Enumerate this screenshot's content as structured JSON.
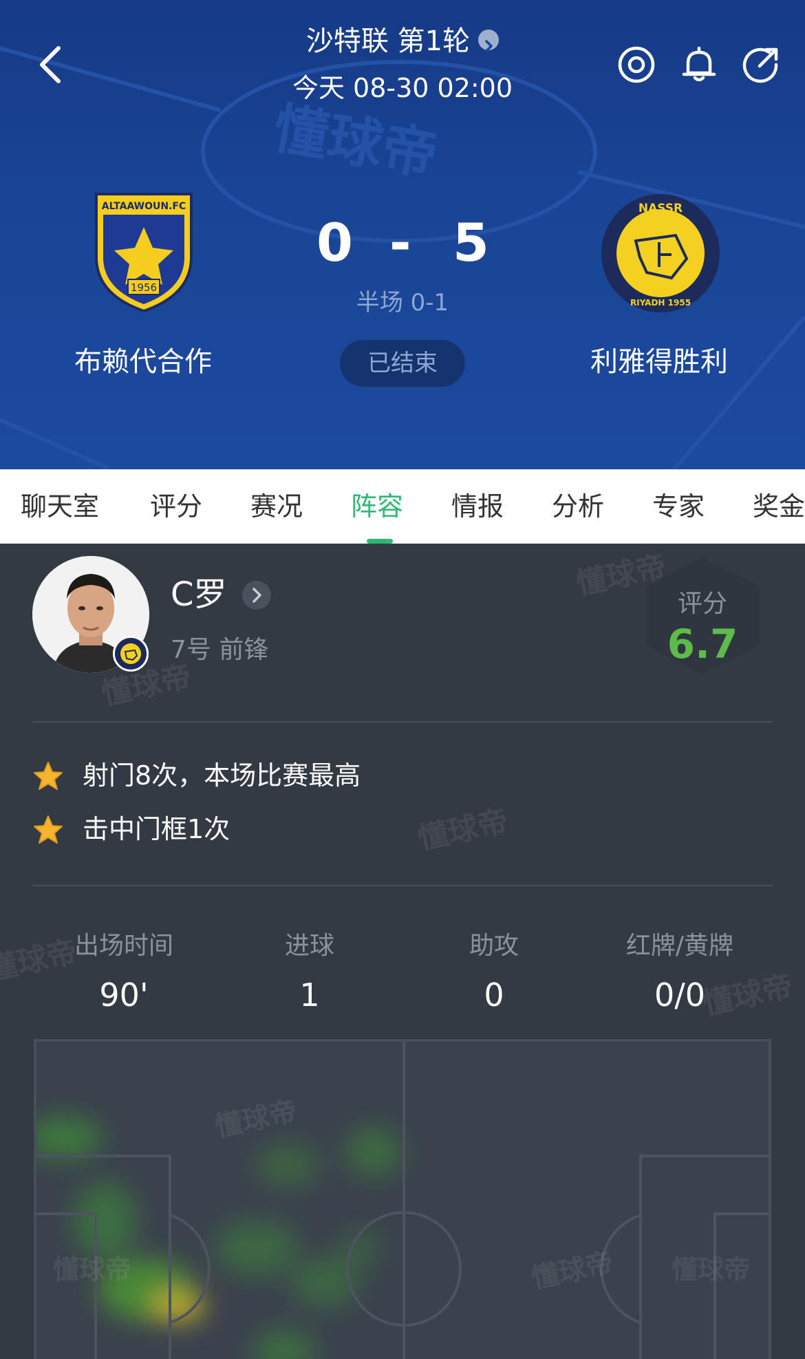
{
  "header": {
    "league": "沙特联 第1轮",
    "datetime": "今天 08-30 02:00",
    "home_team": {
      "name": "布赖代合作",
      "badge_text": "ALTAAWOUN.FC",
      "badge_year": "1956"
    },
    "away_team": {
      "name": "利雅得胜利",
      "badge_text": "NASSR",
      "badge_sub": "RIYADH 1955"
    },
    "home_score": "0",
    "separator": "-",
    "away_score": "5",
    "halftime": "半场 0-1",
    "status": "已结束",
    "watermark": "懂球帝"
  },
  "icons": {
    "back": "back-chevron-icon",
    "target": "target-icon",
    "bell": "bell-icon",
    "share": "share-icon"
  },
  "tabs": [
    {
      "label": "聊天室"
    },
    {
      "label": "评分"
    },
    {
      "label": "赛况"
    },
    {
      "label": "阵容",
      "active": true
    },
    {
      "label": "情报"
    },
    {
      "label": "分析"
    },
    {
      "label": "专家"
    },
    {
      "label": "奖金"
    }
  ],
  "player": {
    "name": "C罗",
    "position": "7号 前锋",
    "rating_label": "评分",
    "rating": "6.7"
  },
  "highlights": [
    {
      "text": "射门8次，本场比赛最高"
    },
    {
      "text": "击中门框1次"
    }
  ],
  "stats": [
    {
      "label": "出场时间",
      "value": "90'"
    },
    {
      "label": "进球",
      "value": "1"
    },
    {
      "label": "助攻",
      "value": "0"
    },
    {
      "label": "红牌/黄牌",
      "value": "0/0"
    }
  ],
  "colors": {
    "header_bg": "#1a4597",
    "accent_green": "#2eb872",
    "rating_green": "#5dbb4a",
    "content_bg": "#343a44"
  }
}
